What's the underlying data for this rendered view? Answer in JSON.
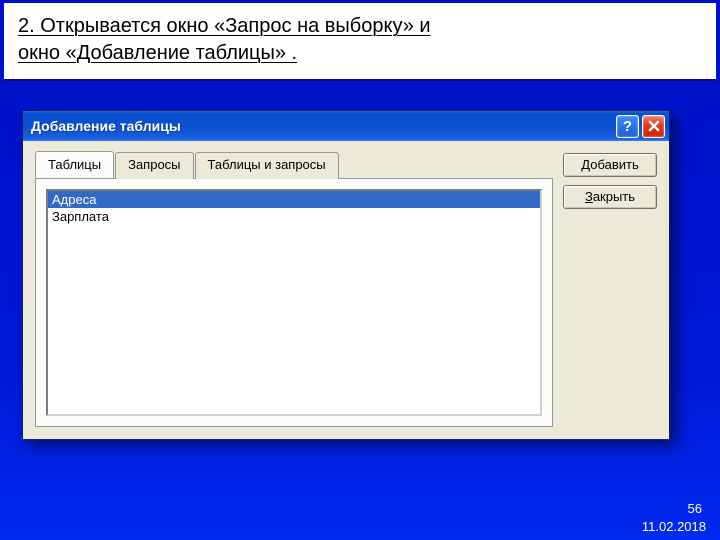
{
  "caption": {
    "line1": "2. Открывается окно «Запрос на выборку» и",
    "line2": "окно «Добавление таблицы» ."
  },
  "dialog": {
    "title": "Добавление таблицы",
    "help_label": "?",
    "tabs": {
      "tables": "Таблицы",
      "queries": "Запросы",
      "both": "Таблицы и запросы"
    },
    "list": {
      "item0": "Адреса",
      "item1": "Зарплата"
    },
    "buttons": {
      "add_pre": "Д",
      "add_rest": "обавить",
      "close_pre": "З",
      "close_rest": "акрыть"
    }
  },
  "footer": {
    "page": "56",
    "date": "11.02.2018"
  }
}
